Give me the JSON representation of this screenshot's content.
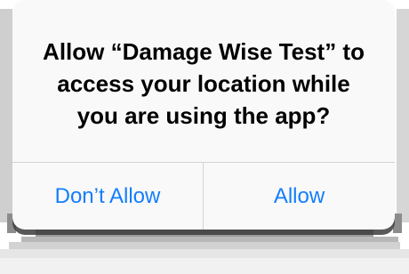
{
  "alert": {
    "message": "Allow “Damage Wise Test” to\naccess your location while\nyou are using the app?",
    "buttons": {
      "dont_allow": "Don’t Allow",
      "allow": "Allow"
    }
  },
  "colors": {
    "accent": "#147efb",
    "alert_background": "#f9f9f9",
    "divider": "#d4d4d6"
  }
}
